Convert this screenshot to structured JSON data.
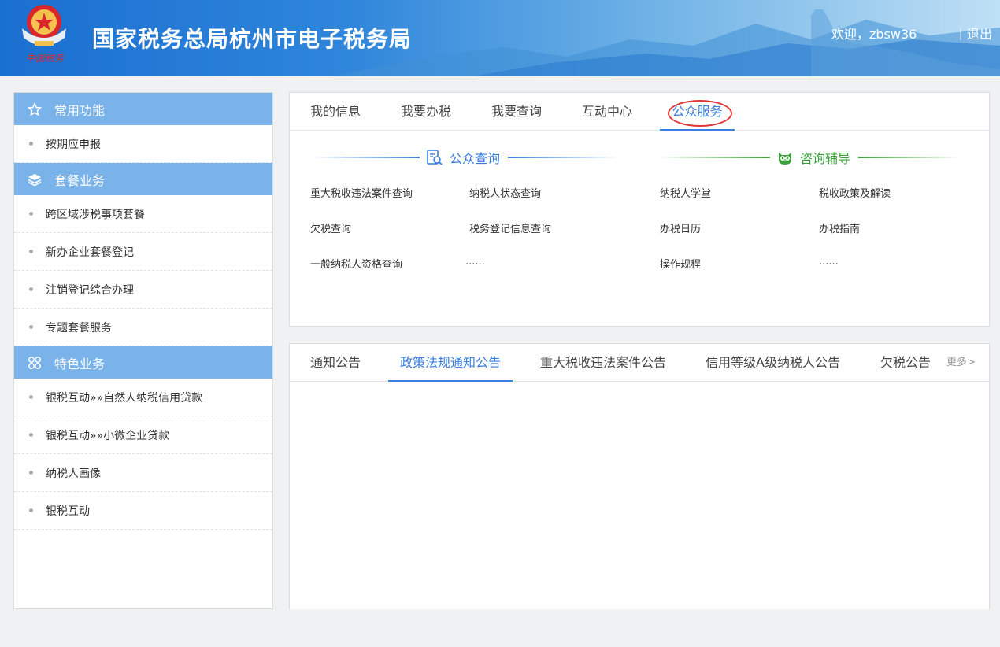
{
  "header": {
    "title": "国家税务总局杭州市电子税务局",
    "welcome": "欢迎，zbsw36",
    "logout": "｜退出",
    "logo_text": "中国税务"
  },
  "sidebar": {
    "groups": [
      {
        "title": "常用功能",
        "icon": "star-icon",
        "items": [
          "按期应申报"
        ]
      },
      {
        "title": "套餐业务",
        "icon": "layers-icon",
        "items": [
          "跨区域涉税事项套餐",
          "新办企业套餐登记",
          "注销登记综合办理",
          "专题套餐服务"
        ]
      },
      {
        "title": "特色业务",
        "icon": "grid-icon",
        "items": [
          "银税互动»»自然人纳税信用贷款",
          "银税互动»»小微企业贷款",
          "纳税人画像",
          "银税互动"
        ]
      }
    ]
  },
  "main_tabs": [
    "我的信息",
    "我要办税",
    "我要查询",
    "互动中心",
    "公众服务"
  ],
  "public_query": {
    "title": "公众查询",
    "links": [
      "重大税收违法案件查询",
      "纳税人状态查询",
      "欠税查询",
      "税务登记信息查询",
      "一般纳税人资格查询",
      "......"
    ]
  },
  "consult": {
    "title": "咨询辅导",
    "links": [
      "纳税人学堂",
      "税收政策及解读",
      "办税日历",
      "办税指南",
      "操作规程",
      "......"
    ]
  },
  "notice_tabs": [
    "通知公告",
    "政策法规通知公告",
    "重大税收违法案件公告",
    "信用等级A级纳税人公告",
    "欠税公告"
  ],
  "more_label": "更多>",
  "colors": {
    "accent": "#3a7ee0",
    "sidebar_header": "#7ab3ea",
    "green": "#3aa13a",
    "highlight_circle": "#e03535"
  }
}
